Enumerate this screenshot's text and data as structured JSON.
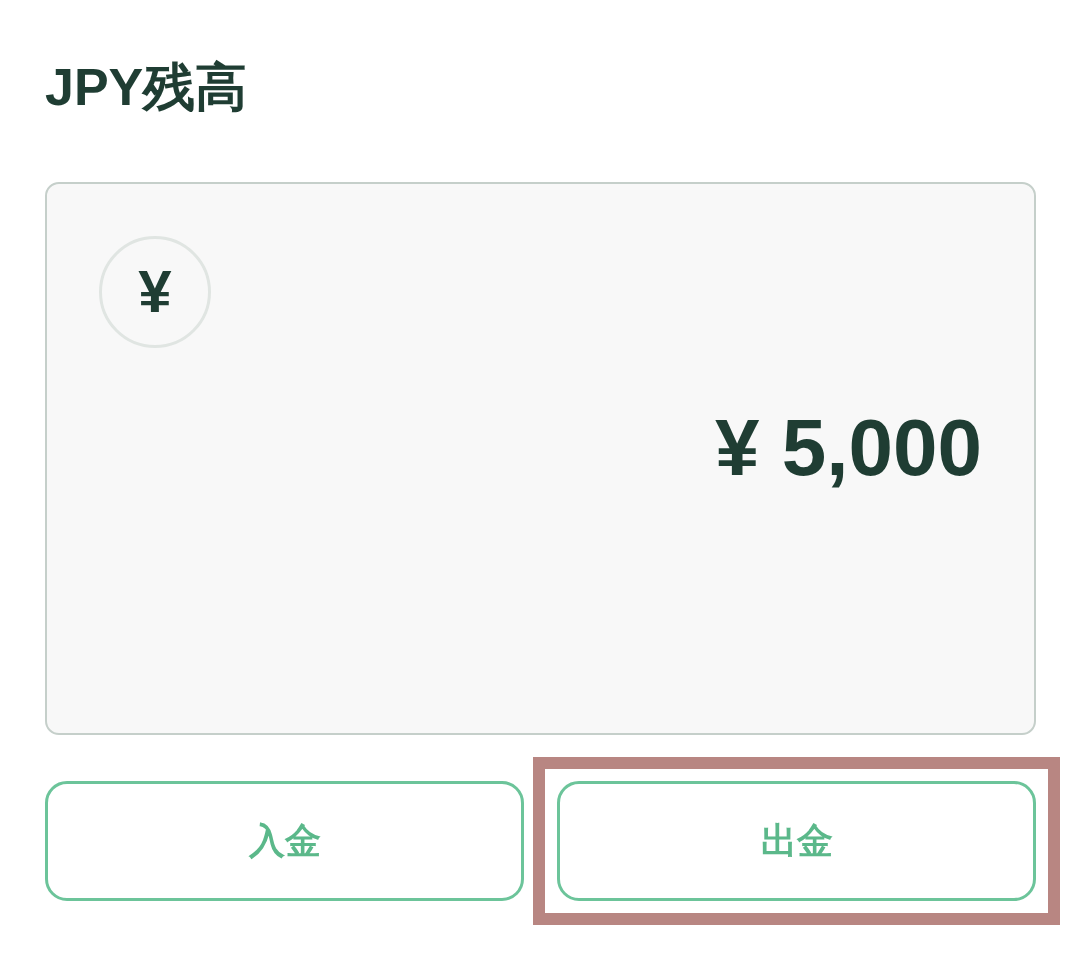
{
  "title": "JPY残高",
  "balance_card": {
    "currency_symbol": "¥",
    "amount": "¥ 5,000"
  },
  "buttons": [
    {
      "label": "入金",
      "highlighted": false
    },
    {
      "label": "出金",
      "highlighted": true
    }
  ]
}
